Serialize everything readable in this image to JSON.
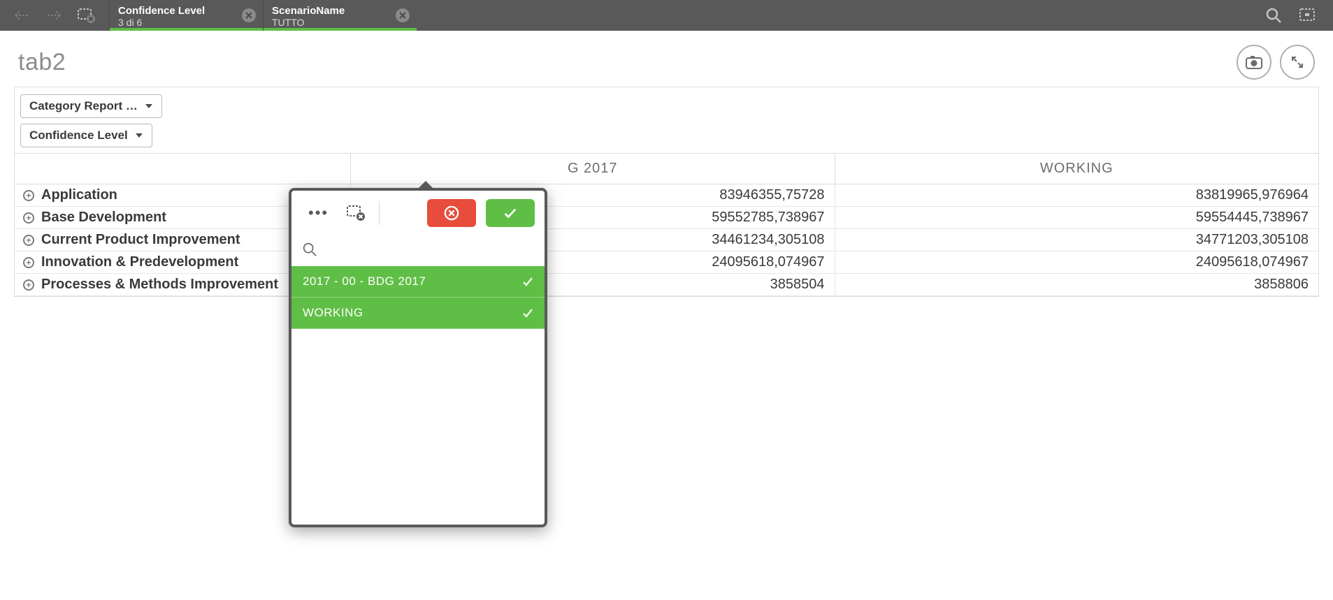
{
  "topbar": {
    "selections": [
      {
        "field": "Confidence Level",
        "summary": "3 di 6"
      },
      {
        "field": "ScenarioName",
        "summary": "TUTTO"
      }
    ]
  },
  "sheet": {
    "title": "tab2"
  },
  "dim_buttons": {
    "category": "Category Report …",
    "confidence": "Confidence Level"
  },
  "pivot": {
    "column_headers": {
      "left": "",
      "c1": "G 2017",
      "c2": "WORKING"
    },
    "rows": [
      {
        "label": "Application",
        "v1": "83946355,75728",
        "v2": "83819965,976964"
      },
      {
        "label": "Base Development",
        "v1": "59552785,738967",
        "v2": "59554445,738967"
      },
      {
        "label": "Current Product Improvement",
        "v1": "34461234,305108",
        "v2": "34771203,305108"
      },
      {
        "label": "Innovation & Predevelopment",
        "v1": "24095618,074967",
        "v2": "24095618,074967"
      },
      {
        "label": "Processes & Methods Improvement",
        "v1": "3858504",
        "v2": "3858806"
      }
    ]
  },
  "popover": {
    "search_placeholder": "",
    "items": [
      {
        "label": "2017 - 00 - BDG 2017"
      },
      {
        "label": "WORKING"
      }
    ]
  }
}
